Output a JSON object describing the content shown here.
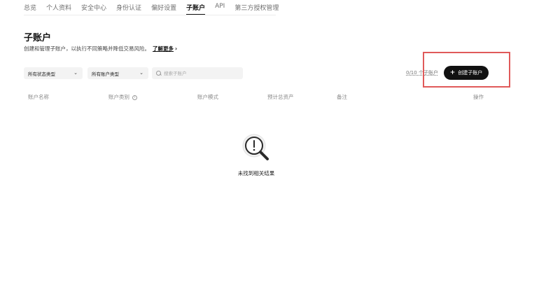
{
  "topnav": {
    "tabs": [
      {
        "label": "总览",
        "active": false
      },
      {
        "label": "个人资料",
        "active": false
      },
      {
        "label": "安全中心",
        "active": false
      },
      {
        "label": "身份认证",
        "active": false
      },
      {
        "label": "偏好设置",
        "active": false
      },
      {
        "label": "子账户",
        "active": true
      },
      {
        "label": "API",
        "active": false
      },
      {
        "label": "第三方授权管理",
        "active": false
      }
    ]
  },
  "header": {
    "title": "子账户",
    "description": "创建和管理子账户，以执行不同策略并降低交易风险。",
    "learn_more": "了解更多",
    "learn_more_chevron": "›"
  },
  "filters": {
    "status_select": "所有状态类型",
    "account_type_select": "所有账户类型",
    "search_placeholder": "搜索子账户"
  },
  "subaccount_counter": "0/10 个子账户",
  "create_button": {
    "icon": "+",
    "label": "创建子账户"
  },
  "table": {
    "columns": [
      "账户名称",
      "账户类别",
      "账户模式",
      "预计总资产",
      "备注",
      "操作"
    ],
    "info_glyph": "i"
  },
  "empty_state": {
    "icon": "magnifier-exclamation-icon",
    "text": "未找到相关结果"
  },
  "colors": {
    "accent": "#111111",
    "highlight": "#e05a5a",
    "muted_text": "#8a8a8a"
  }
}
